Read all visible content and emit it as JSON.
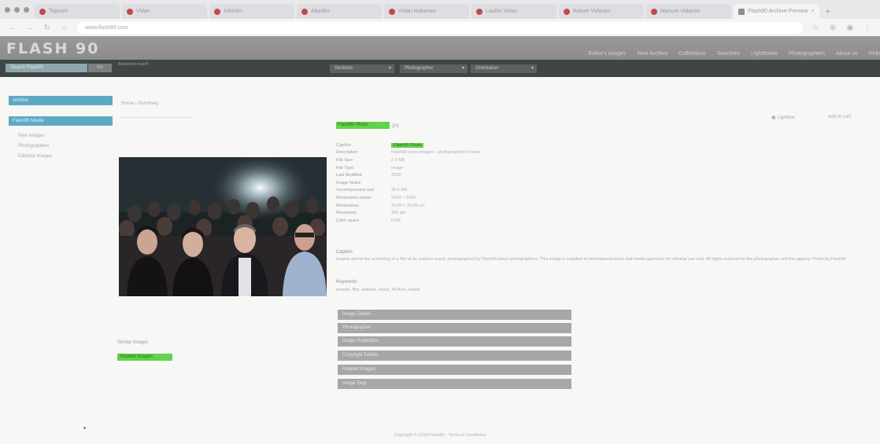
{
  "browser": {
    "tabs": [
      {
        "label": "Tajanim"
      },
      {
        "label": "Vidan"
      },
      {
        "label": "Arbinim"
      },
      {
        "label": "Abadim"
      },
      {
        "label": "Vidan Hakamor"
      },
      {
        "label": "Laulim Vidan"
      },
      {
        "label": "Ratum Vidanim"
      },
      {
        "label": "Manum Vidanim"
      },
      {
        "label": "Flash90 Archive Preview",
        "active": true
      }
    ],
    "url": "www.flash90.com"
  },
  "site": {
    "logo": "FLASH 90",
    "nav": [
      "Editor's images",
      "New Archive",
      "Collections",
      "Searches",
      "Lightboxes",
      "Photographers",
      "About us",
      "Help"
    ],
    "search_placeholder": "Search Flash90",
    "search_button": "Go",
    "search_hint": "Advanced search",
    "filters": [
      "Sections",
      "Photographer",
      "Orientation"
    ]
  },
  "sidebar": {
    "buttons": [
      "Archive",
      "Flash90 Media"
    ],
    "links": [
      "New Images",
      "Photographers",
      "Editorial Images"
    ]
  },
  "main": {
    "breadcrumb": "Home › Summary",
    "tools": [
      "Lightbox",
      "Add to cart"
    ],
    "image_id": "Flash90 Photo",
    "image_id_ext": ".jpg",
    "meta": [
      {
        "k": "Caption",
        "v": "Flash90 Photo",
        "hl": true
      },
      {
        "k": "Description",
        "v": "Flash90 press images - photographed in Israel",
        "link": true
      },
      {
        "k": "File Size",
        "v": "2.6 MB"
      },
      {
        "k": "File Type",
        "v": "Image"
      },
      {
        "k": "Last Modified",
        "v": "2018"
      },
      {
        "k": "Image Notes",
        "v": ""
      },
      {
        "k": "Uncompressed size",
        "v": "36.6 MB"
      },
      {
        "k": "Dimensions pixels",
        "v": "5184 × 3456"
      },
      {
        "k": "Dimensions",
        "v": "43.89 × 29.26 cm"
      },
      {
        "k": "Resolution",
        "v": "300 dpi"
      },
      {
        "k": "Color space",
        "v": "RGB"
      }
    ],
    "caption_heading": "Caption",
    "caption_text": "Israelis attend the screening of a film at an outdoor event, photographed by Flash90 press photographers. This image is supplied to international press and media agencies for editorial use only. All rights reserved to the photographer and the agency. Photo by Flash90",
    "keywords_heading": "Keywords",
    "keywords_text": "Israelis, film, outdoor, event, Tel Aviv, crowd",
    "accordion": [
      "Image Details",
      "Photographer",
      "Image Properties",
      "Copyright Details",
      "Related Images",
      "Image Tags"
    ],
    "similar_heading": "Similar images",
    "similar_button": "Related Images",
    "footer": "Copyright © 2018 Flash90 · Terms & Conditions"
  }
}
